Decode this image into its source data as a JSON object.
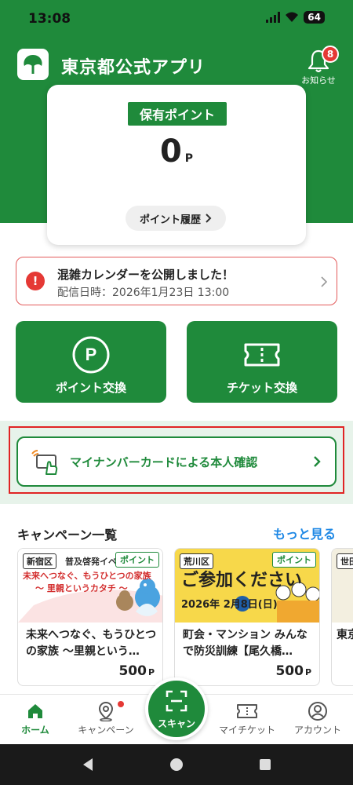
{
  "status": {
    "time": "13:08",
    "battery": "64"
  },
  "app": {
    "title": "東京都公式アプリ"
  },
  "notifications": {
    "count": "8",
    "label": "お知らせ"
  },
  "points": {
    "label": "保有ポイント",
    "value": "0",
    "unit": "P",
    "history_label": "ポイント履歴"
  },
  "notice": {
    "title": "混雑カレンダーを公開しました！",
    "date": "配信日時：2026年1月23日 13:00"
  },
  "actions": {
    "point_exchange": "ポイント交換",
    "ticket_exchange": "チケット交換"
  },
  "mynumber": {
    "label": "マイナンバーカードによる本人確認"
  },
  "campaigns": {
    "title": "キャンペーン一覧",
    "see_more": "もっと見る",
    "items": [
      {
        "region": "新宿区",
        "badge": "ポイント",
        "banner_top": "普及啓発イベント",
        "banner_main": "未来へつなぐ、もうひとつの家族",
        "banner_sub": "～ 里親というカタチ ～",
        "text": "未来へつなぐ、もうひとつの家族 ～里親という…",
        "points": "500",
        "unit": "P"
      },
      {
        "region": "荒川区",
        "badge": "ポイント",
        "banner_main": "ご参加ください",
        "banner_sub": "2026年 2月8日(日)",
        "text": "町会・マンション みんなで防災訓練【尾久橋…",
        "points": "500",
        "unit": "P"
      },
      {
        "region": "世田",
        "text": "東京「賢"
      }
    ]
  },
  "tabs": {
    "home": "ホーム",
    "campaign": "キャンペーン",
    "scan": "スキャン",
    "my_ticket": "マイチケット",
    "account": "アカウント"
  },
  "colors": {
    "brand_green": "#1f8a3b",
    "alert_red": "#e53935",
    "link_blue": "#1e88e5"
  }
}
